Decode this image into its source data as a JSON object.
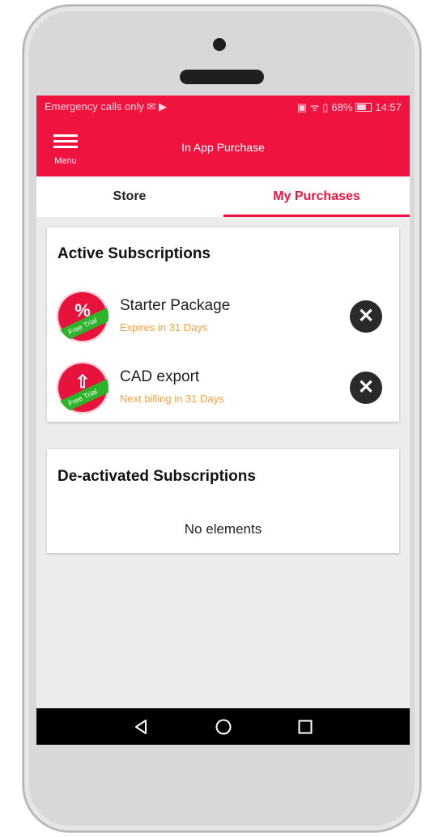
{
  "status_bar": {
    "left_text": "Emergency calls only",
    "left_icons": "✉ ▶",
    "right_signal": "▣ ᯤ ▯",
    "battery_percent": "68%",
    "time": "14:57"
  },
  "app_bar": {
    "menu_label": "Menu",
    "title": "In App Purchase"
  },
  "tabs": [
    {
      "label": "Store",
      "selected": false
    },
    {
      "label": "My Purchases",
      "selected": true
    }
  ],
  "active_subscriptions": {
    "title": "Active Subscriptions",
    "items": [
      {
        "name": "Starter Package",
        "note": "Expires in 31 Days",
        "badge_icon": "percent-icon",
        "badge_glyph": "%",
        "ribbon": "Free Trial"
      },
      {
        "name": "CAD export",
        "note": "Next billing in 31 Days",
        "badge_icon": "export-icon",
        "badge_glyph": "⇧",
        "ribbon": "Free Trial"
      }
    ]
  },
  "deactivated_subscriptions": {
    "title": "De-activated Subscriptions",
    "empty_text": "No elements"
  },
  "colors": {
    "primary": "#f0133f",
    "note": "#f6a03a",
    "ribbon": "#2db32a"
  }
}
